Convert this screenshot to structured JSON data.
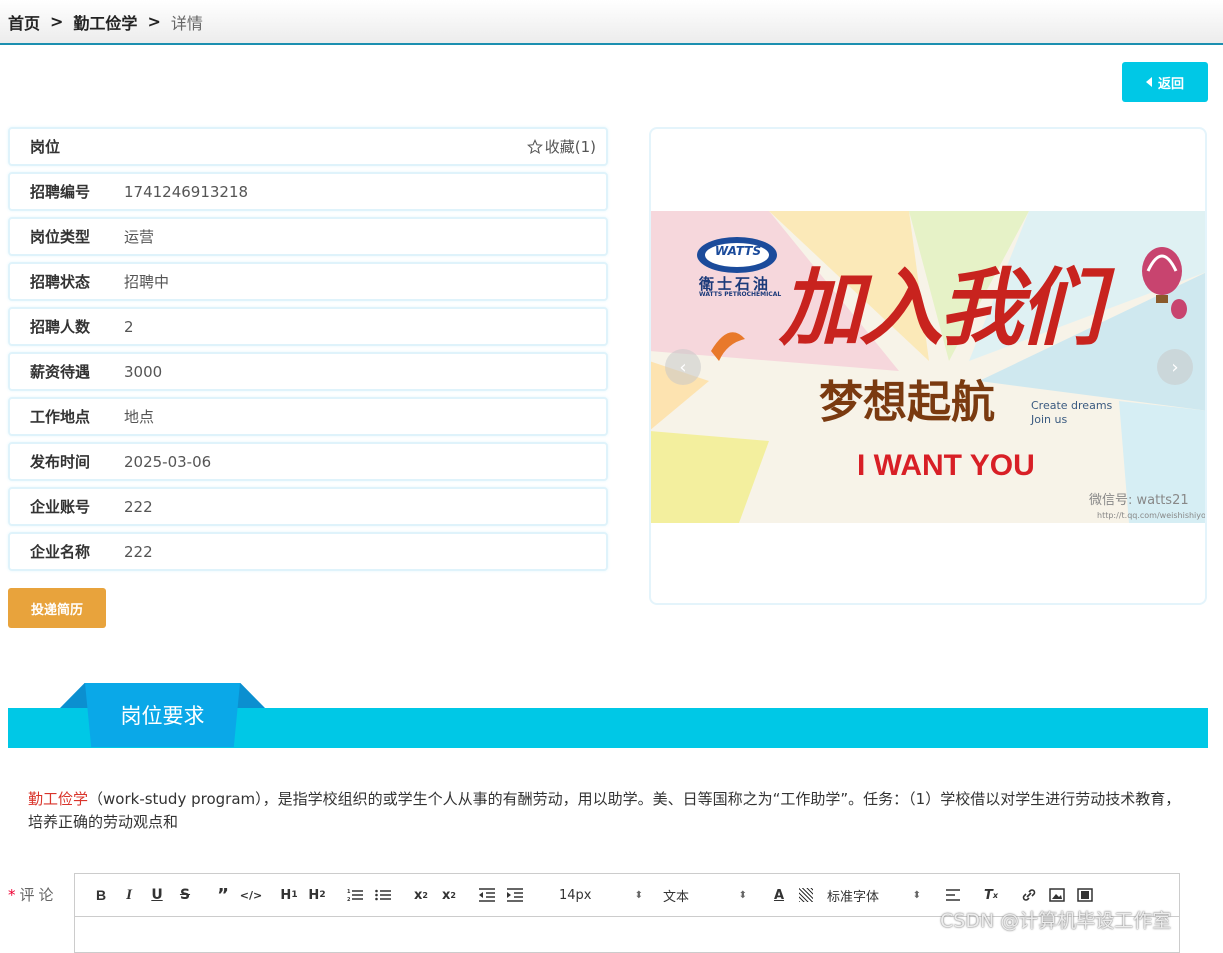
{
  "breadcrumb": {
    "home": "首页",
    "section": "勤工俭学",
    "current": "详情",
    "separator": ">"
  },
  "back_button": {
    "label": "返回"
  },
  "job": {
    "header_label": "岗位",
    "favorite": {
      "label": "收藏(1)"
    },
    "fields": [
      {
        "label": "招聘编号",
        "value": "1741246913218"
      },
      {
        "label": "岗位类型",
        "value": "运营"
      },
      {
        "label": "招聘状态",
        "value": "招聘中"
      },
      {
        "label": "招聘人数",
        "value": "2"
      },
      {
        "label": "薪资待遇",
        "value": "3000"
      },
      {
        "label": "工作地点",
        "value": "地点"
      },
      {
        "label": "发布时间",
        "value": "2025-03-06"
      },
      {
        "label": "企业账号",
        "value": "222"
      },
      {
        "label": "企业名称",
        "value": "222"
      }
    ],
    "apply_button": "投递简历"
  },
  "banner": {
    "brand": "WATTS",
    "brand_cn": "衛士石油",
    "brand_en": "WATTS PETROCHEMICAL",
    "headline": "加入我们",
    "subline": "梦想起航",
    "tagline_1": "Create dreams",
    "tagline_2": "Join us",
    "slogan": "I WANT YOU",
    "wechat": "微信号: watts21",
    "url": "http://t.qq.com/weishishiyou",
    "prev_icon": "‹",
    "next_icon": "›"
  },
  "section": {
    "title": "岗位要求"
  },
  "description": {
    "highlight": "勤工俭学",
    "text": "（work-study program），是指学校组织的或学生个人从事的有酬劳动，用以助学。美、日等国称之为“工作助学”。任务：（1）学校借以对学生进行劳动技术教育，培养正确的劳动观点和"
  },
  "comment": {
    "required_mark": "*",
    "label": "评论",
    "toolbar": {
      "size": "14px",
      "header": "文本",
      "font": "标准字体"
    }
  },
  "watermark": "CSDN @计算机毕设工作室",
  "colors": {
    "accent": "#00c8e6",
    "apply": "#e8a33c",
    "section_tab": "#0aa8e8",
    "highlight": "#d9342b"
  }
}
